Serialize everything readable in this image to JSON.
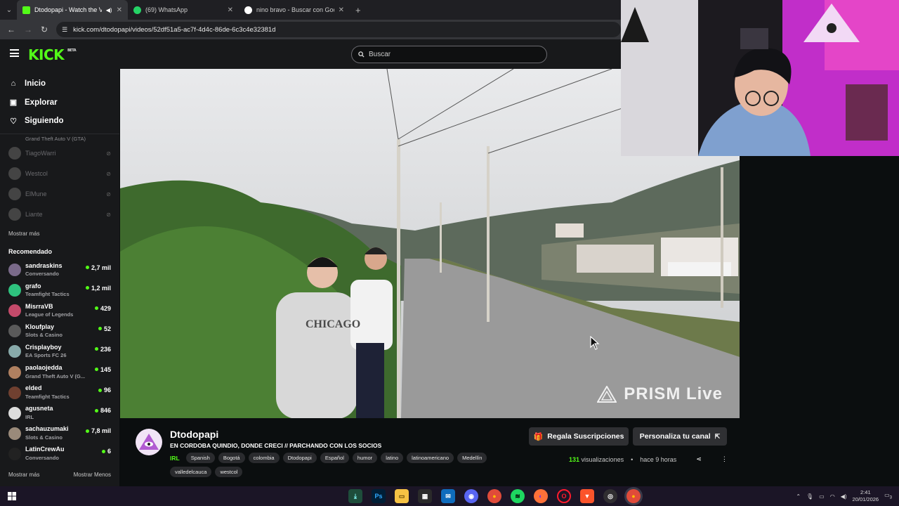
{
  "browser": {
    "tabs": [
      {
        "title": "Dtodopapi - Watch the VOD",
        "active": true,
        "favicon_color": "#53fc18"
      },
      {
        "title": "(69) WhatsApp",
        "active": false,
        "favicon_color": "#25d366"
      },
      {
        "title": "nino bravo - Buscar con Google",
        "active": false,
        "favicon_color": "#4285f4"
      }
    ],
    "url": "kick.com/dtodopapi/videos/52df51a5-ac7f-4d4c-86de-6c3c4e32381d"
  },
  "header": {
    "logo": "KICK",
    "logo_badge": "BETA",
    "search_placeholder": "Buscar"
  },
  "sidebar": {
    "nav": [
      {
        "label": "Inicio",
        "icon": "home-icon"
      },
      {
        "label": "Explorar",
        "icon": "compass-icon"
      },
      {
        "label": "Siguiendo",
        "icon": "heart-icon"
      }
    ],
    "following_partial_category": "Grand Theft Auto V (GTA)",
    "following": [
      {
        "name": "TiagoWarri"
      },
      {
        "name": "Westcol"
      },
      {
        "name": "ElMune"
      },
      {
        "name": "Liante"
      }
    ],
    "show_more": "Mostrar más",
    "recommended_title": "Recomendado",
    "recommended": [
      {
        "name": "sandraskins",
        "category": "Conversando",
        "viewers": "2,7 mil",
        "color": "#7a6a8a"
      },
      {
        "name": "grafo",
        "category": "Teamfight Tactics",
        "viewers": "1,2 mil",
        "color": "#2ec27e"
      },
      {
        "name": "MisrraVB",
        "category": "League of Legends",
        "viewers": "429",
        "color": "#c44a6a"
      },
      {
        "name": "Kloufplay",
        "category": "Slots & Casino",
        "viewers": "52",
        "color": "#5a5a5a"
      },
      {
        "name": "Crisplayboy",
        "category": "EA Sports FC 26",
        "viewers": "236",
        "color": "#8aa"
      },
      {
        "name": "paolaojedda",
        "category": "Grand Theft Auto V (G...",
        "viewers": "145",
        "color": "#b08060"
      },
      {
        "name": "elded",
        "category": "Teamfight Tactics",
        "viewers": "96",
        "color": "#704030"
      },
      {
        "name": "agusneta",
        "category": "IRL",
        "viewers": "846",
        "color": "#ddd"
      },
      {
        "name": "sachauzumaki",
        "category": "Slots & Casino",
        "viewers": "7,8 mil",
        "color": "#9a8a7a"
      },
      {
        "name": "LatinCrewAu",
        "category": "Conversando",
        "viewers": "6",
        "color": "#222"
      }
    ],
    "bottom_more": "Mostrar más",
    "bottom_less": "Mostrar Menos"
  },
  "video": {
    "watermark": "PRISM Live"
  },
  "channel": {
    "name": "Dtodopapi",
    "title": "EN CORDOBA QUINDIO, DONDE CRECI // PARCHANDO CON LOS SOCIOS",
    "category": "IRL",
    "tags": [
      "Spanish",
      "Bogotá",
      "colombia",
      "Dtodopapi",
      "Español",
      "humor",
      "latino",
      "latinoamericano",
      "Medellín",
      "valledelcauca",
      "westcol"
    ],
    "gift_button": "Regala Suscripciones",
    "customize_button": "Personaliza tu canal",
    "views_count": "131",
    "views_label": "visualizaciones",
    "age": "hace 9 horas"
  },
  "taskbar": {
    "time": "2:41",
    "date": "20/01/2026",
    "notifications": "3"
  }
}
